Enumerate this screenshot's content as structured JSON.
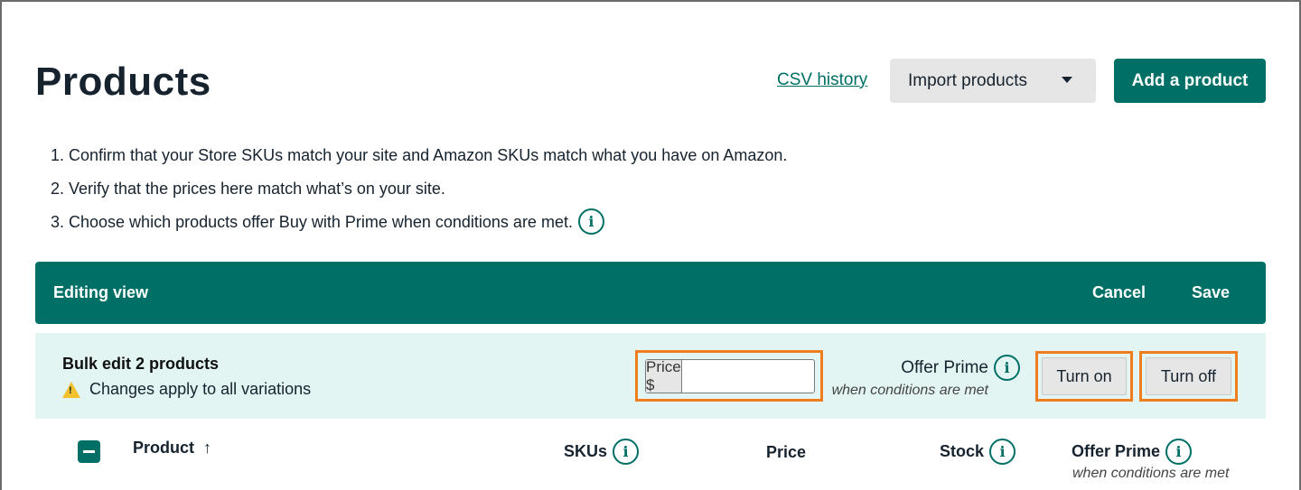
{
  "header": {
    "title": "Products",
    "csv_history": "CSV history",
    "import_label": "Import products",
    "add_label": "Add a product"
  },
  "steps": [
    "1. Confirm that your Store SKUs match your site and Amazon SKUs match what you have on Amazon.",
    "2. Verify that the prices here match what’s on your site.",
    "3. Choose which products offer Buy with Prime when conditions are met."
  ],
  "edit_bar": {
    "label": "Editing view",
    "cancel": "Cancel",
    "save": "Save"
  },
  "bulk": {
    "title": "Bulk edit 2 products",
    "note": "Changes apply to all variations",
    "price_prefix": "Price $",
    "price_value": "",
    "offer_label": "Offer Prime",
    "offer_sub": "when conditions are met",
    "turn_on": "Turn on",
    "turn_off": "Turn off"
  },
  "table": {
    "columns": {
      "product": "Product",
      "skus": "SKUs",
      "price": "Price",
      "stock": "Stock",
      "offer_prime": "Offer Prime",
      "offer_prime_sub": "when conditions are met"
    }
  },
  "colors": {
    "accent": "#007066",
    "highlight": "#f07d1e",
    "bulk_bg": "#e3f5f3"
  },
  "icons": {
    "info": "info-icon",
    "warning": "warning-icon",
    "caret": "caret-down-icon",
    "sort": "sort-up-icon"
  }
}
